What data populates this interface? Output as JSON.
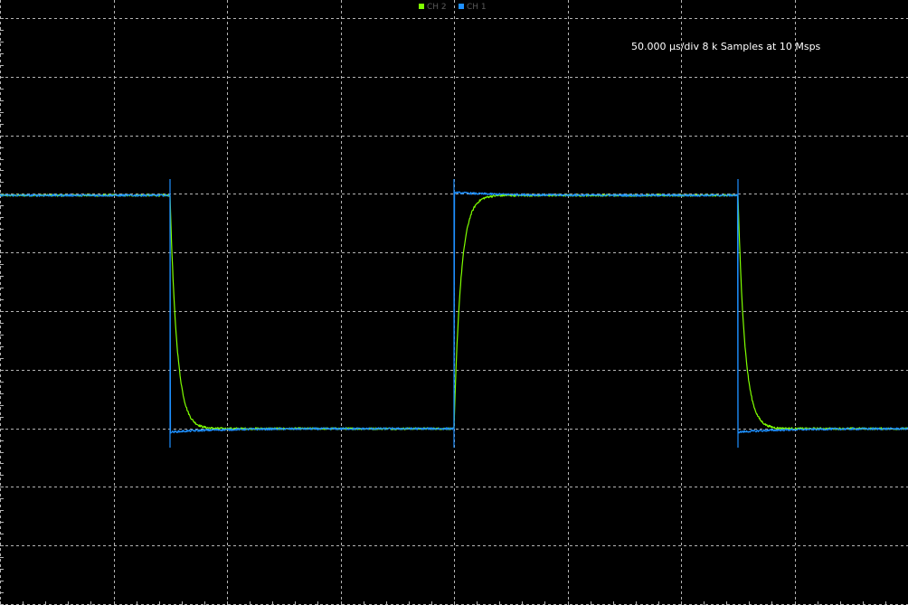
{
  "acquisition": {
    "info": "50.000 µs/div 8 k Samples at 10 Msps"
  },
  "legend": {
    "items": [
      {
        "label": "CH 2",
        "color": "#7fff00"
      },
      {
        "label": "CH 1",
        "color": "#1e90ff"
      }
    ]
  },
  "colors": {
    "background": "#000000",
    "grid": "#b4b4b4",
    "ch1": "#1e90ff",
    "ch2": "#7fff00"
  },
  "chart_data": {
    "type": "line",
    "title": "",
    "xlabel": "",
    "ylabel": "",
    "x_units": "µs",
    "x_per_div": 50,
    "xlim": [
      0,
      400
    ],
    "ylim": [
      -5,
      5
    ],
    "y_divisions": 10,
    "x_divisions": 8,
    "grid": true,
    "legend_position": "top-center",
    "series": [
      {
        "name": "CH 2",
        "color": "#7fff00",
        "shape": "rc-response",
        "high": 3.0,
        "low": -1.0,
        "time_constant_us": 6,
        "transitions": [
          {
            "t": 146,
            "dir": "fall"
          },
          {
            "t": 396,
            "dir": "rise"
          },
          {
            "t": 646,
            "dir": "fall"
          }
        ],
        "initial_level": "high"
      },
      {
        "name": "CH 1",
        "color": "#1e90ff",
        "shape": "square",
        "high": 3.0,
        "low": -1.05,
        "transitions": [
          {
            "t": 146,
            "dir": "fall"
          },
          {
            "t": 396,
            "dir": "rise"
          },
          {
            "t": 646,
            "dir": "fall"
          }
        ],
        "initial_level": "high"
      }
    ]
  }
}
